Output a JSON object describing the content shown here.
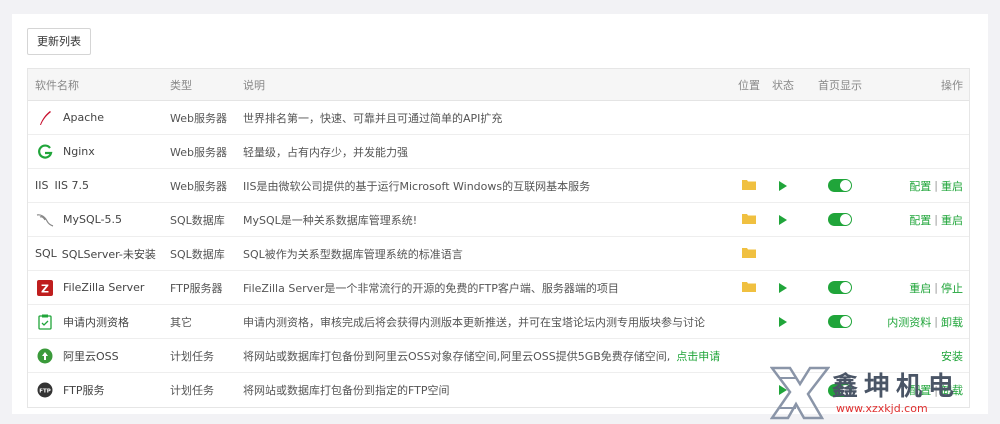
{
  "toolbar": {
    "refresh_label": "更新列表"
  },
  "table": {
    "headers": {
      "name": "软件名称",
      "type": "类型",
      "desc": "说明",
      "pos": "位置",
      "status": "状态",
      "home": "首页显示",
      "ops": "操作"
    },
    "rows": [
      {
        "name": "Apache",
        "type": "Web服务器",
        "desc": "世界排名第一，快速、可靠并且可通过简单的API扩充"
      },
      {
        "name": "Nginx",
        "type": "Web服务器",
        "desc": "轻量级，占有内存少，并发能力强"
      },
      {
        "name": "IIS 7.5",
        "icon_text": "IIS",
        "type": "Web服务器",
        "desc": "IIS是由微软公司提供的基于运行Microsoft Windows的互联网基本服务",
        "op1": "配置",
        "op2": "重启"
      },
      {
        "name": "MySQL-5.5",
        "type": "SQL数据库",
        "desc": "MySQL是一种关系数据库管理系统!",
        "op1": "配置",
        "op2": "重启"
      },
      {
        "name": "SQLServer-未安装",
        "icon_text": "SQL",
        "type": "SQL数据库",
        "desc": "SQL被作为关系型数据库管理系统的标准语言"
      },
      {
        "name": "FileZilla Server",
        "type": "FTP服务器",
        "desc": "FileZilla Server是一个非常流行的开源的免费的FTP客户端、服务器端的项目",
        "op1": "重启",
        "op2": "停止"
      },
      {
        "name": "申请内测资格",
        "type": "其它",
        "desc": "申请内测资格，审核完成后将会获得内测版本更新推送，并可在宝塔论坛内测专用版块参与讨论",
        "op1": "内测资料",
        "op2": "卸载"
      },
      {
        "name": "阿里云OSS",
        "type": "计划任务",
        "desc": "将网站或数据库打包备份到阿里云OSS对象存储空间,阿里云OSS提供5GB免费存储空间,",
        "link": "点击申请",
        "op1": "安装"
      },
      {
        "name": "FTP服务",
        "icon_text": "FTP",
        "type": "计划任务",
        "desc": "将网站或数据库打包备份到指定的FTP空间",
        "op1": "配置",
        "op2": "卸载"
      }
    ]
  },
  "watermark": {
    "text": "鑫坤机电",
    "url": "www.xzxkjd.com"
  },
  "colors": {
    "accent": "#20a53a",
    "folder": "#f0c040"
  }
}
